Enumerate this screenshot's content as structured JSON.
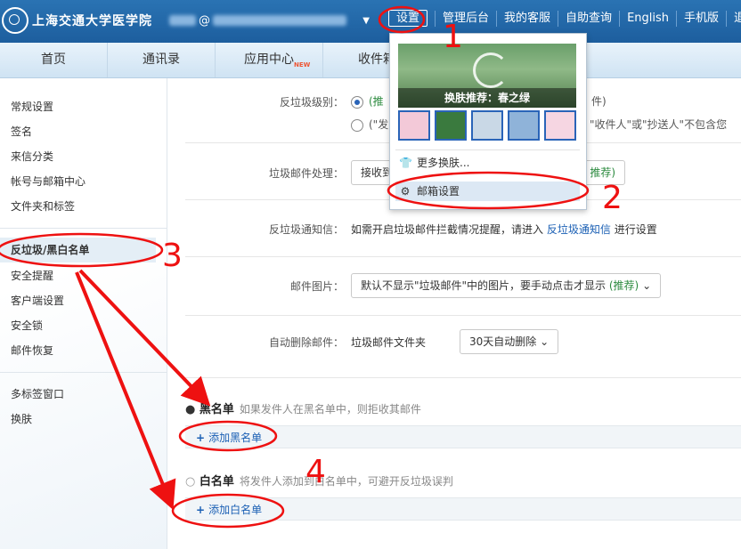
{
  "header": {
    "logo_text": "上海交通大学医学院",
    "account_suffix": "@",
    "links": [
      "设置",
      "管理后台",
      "我的客服",
      "自助查询",
      "English",
      "手机版",
      "退"
    ]
  },
  "nav": {
    "tabs": [
      {
        "label": "首页",
        "badge": ""
      },
      {
        "label": "通讯录",
        "badge": ""
      },
      {
        "label": "应用中心",
        "badge": "NEW"
      },
      {
        "label": "收件箱",
        "badge": ""
      }
    ]
  },
  "sidebar": {
    "items": [
      "常规设置",
      "签名",
      "来信分类",
      "帐号与邮箱中心",
      "文件夹和标签",
      "反垃圾/黑白名单",
      "安全提醒",
      "客户端设置",
      "安全锁",
      "邮件恢复",
      "多标签窗口",
      "换肤"
    ],
    "active_index": 5
  },
  "settings": {
    "spam_level": {
      "label": "反垃圾级别：",
      "option1_prefix": "(推",
      "option1_tail": "件)",
      "option2_prefix": "(\"发",
      "option2_tail": "\"收件人\"或\"抄送人\"不包含您"
    },
    "spam_handling": {
      "label": "垃圾邮件处理：",
      "value_prefix": "接收到",
      "recommend": "推荐)"
    },
    "spam_notice": {
      "label": "反垃圾通知信：",
      "text_before": "如需开启垃圾邮件拦截情况提醒，请进入",
      "link": "反垃圾通知信",
      "text_after": "进行设置"
    },
    "spam_images": {
      "label": "邮件图片：",
      "value": "默认不显示\"垃圾邮件\"中的图片，要手动点击才显示",
      "recommend": "(推荐)"
    },
    "auto_delete": {
      "label": "自动删除邮件：",
      "folder": "垃圾邮件文件夹",
      "value": "30天自动删除"
    }
  },
  "blacklist": {
    "title": "黑名单",
    "desc": "如果发件人在黑名单中，则拒收其邮件",
    "add": "添加黑名单"
  },
  "whitelist": {
    "title": "白名单",
    "desc": "将发件人添加到白名单中，可避开反垃圾误判",
    "add": "添加白名单"
  },
  "dropdown": {
    "skin_caption": "换肤推荐：春之绿",
    "thumbs": [
      "#f3c9d8",
      "#3a7a3e",
      "#c9d8e6",
      "#8fb3d9",
      "#f6d6e2"
    ],
    "more_skins": "更多换肤...",
    "mail_settings": "邮箱设置"
  },
  "annotations": {
    "numbers": [
      "1",
      "2",
      "3",
      "4"
    ],
    "color": "#ee1111"
  }
}
